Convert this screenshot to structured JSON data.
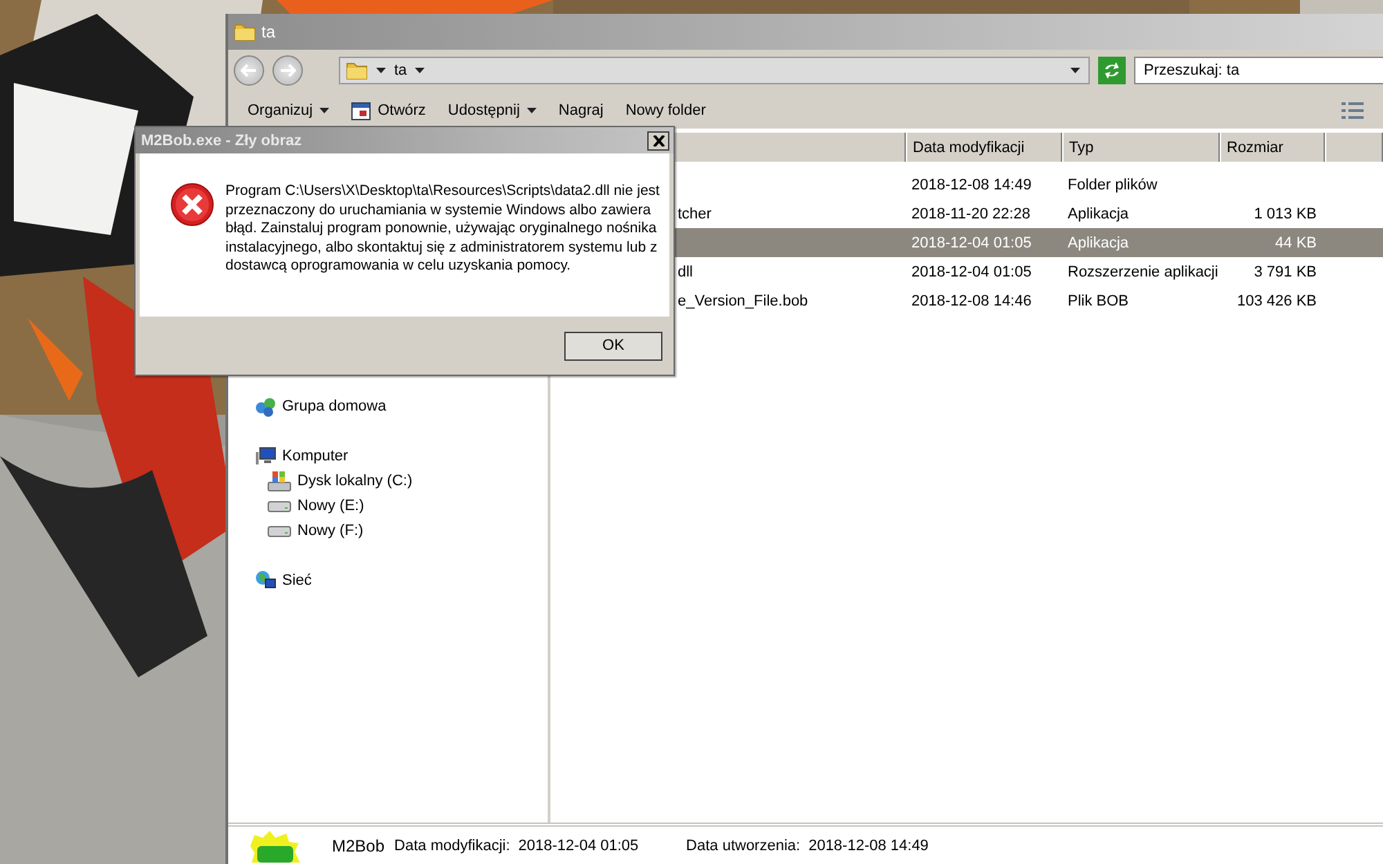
{
  "window": {
    "title": "ta",
    "address": {
      "path": "ta"
    },
    "search": {
      "placeholder": "Przeszukaj: ta"
    },
    "toolbar": [
      {
        "label": "Organizuj",
        "kind": "menu"
      },
      {
        "label": "Otwórz",
        "kind": "icon"
      },
      {
        "label": "Udostępnij",
        "kind": "menu"
      },
      {
        "label": "Nagraj",
        "kind": "plain"
      },
      {
        "label": "Nowy folder",
        "kind": "plain"
      }
    ],
    "navigation": {
      "items": [
        {
          "label": "Grupa domowa",
          "kind": "homegroup"
        },
        {
          "label": "Komputer",
          "kind": "computer",
          "children": [
            {
              "label": "Dysk lokalny (C:)",
              "kind": "system-drive"
            },
            {
              "label": "Nowy (E:)",
              "kind": "drive"
            },
            {
              "label": "Nowy (F:)",
              "kind": "drive"
            }
          ]
        },
        {
          "label": "Sieć",
          "kind": "network"
        }
      ]
    },
    "file_list": {
      "columns": [
        "Data modyfikacji",
        "Typ",
        "Rozmiar"
      ],
      "rows": [
        {
          "modified": "2018-12-08 14:49",
          "type": "Folder plików",
          "selected": false
        },
        {
          "name": "tcher",
          "modified": "2018-11-20 22:28",
          "type": "Aplikacja",
          "size": "1 013 KB",
          "selected": false
        },
        {
          "modified": "2018-12-04 01:05",
          "type": "Aplikacja",
          "size": "44 KB",
          "selected": true
        },
        {
          "name": "dll",
          "modified": "2018-12-04 01:05",
          "type": "Rozszerzenie aplikacji",
          "size": "3 791 KB",
          "selected": false
        },
        {
          "name": "e_Version_File.bob",
          "modified": "2018-12-08 14:46",
          "type": "Plik BOB",
          "size": "103 426 KB",
          "selected": false
        }
      ]
    },
    "details_pane": {
      "name": "M2Bob",
      "fields": [
        {
          "label": "Data modyfikacji:",
          "value": "2018-12-04 01:05"
        },
        {
          "label": "Data utworzenia:",
          "value": "2018-12-08 14:49"
        }
      ]
    }
  },
  "dialog": {
    "title": "M2Bob.exe - Zły obraz",
    "message": "Program C:\\Users\\X\\Desktop\\ta\\Resources\\Scripts\\data2.dll nie jest przeznaczony do uruchamiania w systemie Windows albo zawiera błąd. Zainstaluj program ponownie, używając oryginalnego nośnika instalacyjnego, albo skontaktuj się z administratorem systemu lub z dostawcą oprogramowania w celu uzyskania pomocy.",
    "buttons": [
      "OK"
    ]
  }
}
